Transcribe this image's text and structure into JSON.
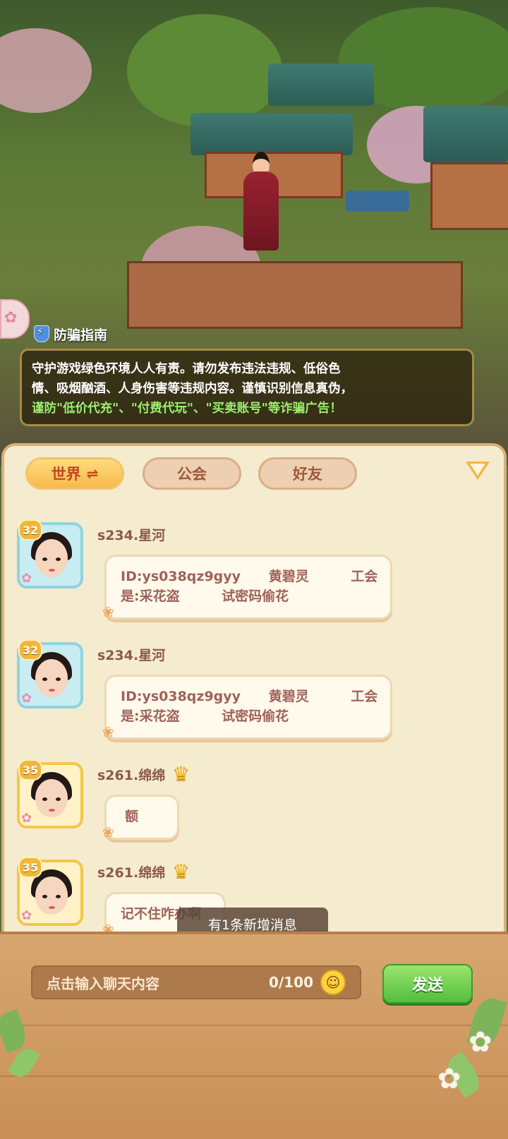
{
  "notice": {
    "title": "防骗指南",
    "line1": "守护游戏绿色环境人人有责。请勿发布违法违规、低俗色",
    "line2": "情、吸烟酗酒、人身伤害等违规内容。谨慎识别信息真伪，",
    "line3_warn": "谨防\"低价代充\"、\"付费代玩\"、\"买卖账号\"等诈骗广告！"
  },
  "tabs": {
    "world": "世界",
    "world_icon": "⇌",
    "guild": "公会",
    "friends": "好友"
  },
  "messages": [
    {
      "level": "32",
      "name": "s234.星河",
      "line1": "ID:ys038qz9gyy      黄碧灵         工会",
      "line2": "是:采花盗         试密码偷花",
      "avatar_frame": "blue"
    },
    {
      "level": "32",
      "name": "s234.星河",
      "line1": "ID:ys038qz9gyy      黄碧灵         工会",
      "line2": "是:采花盗         试密码偷花",
      "avatar_frame": "blue"
    },
    {
      "level": "35",
      "name": "s261.绵绵",
      "line1": "额",
      "line2": "",
      "avatar_frame": "gold",
      "crown": true
    },
    {
      "level": "35",
      "name": "s261.绵绵",
      "line1": "记不住咋办啊",
      "line2": "",
      "avatar_frame": "gold",
      "crown": true
    }
  ],
  "toast": "有1条新增消息",
  "input": {
    "placeholder": "点击输入聊天内容",
    "count": "0/100",
    "send": "发送"
  },
  "icons": [
    "shield-icon",
    "swap-icon",
    "dropdown-icon",
    "crown-icon",
    "emoji-icon"
  ],
  "colors": {
    "accent": "#f6b94b",
    "send": "#53be3e",
    "warn": "#9bf06d"
  }
}
